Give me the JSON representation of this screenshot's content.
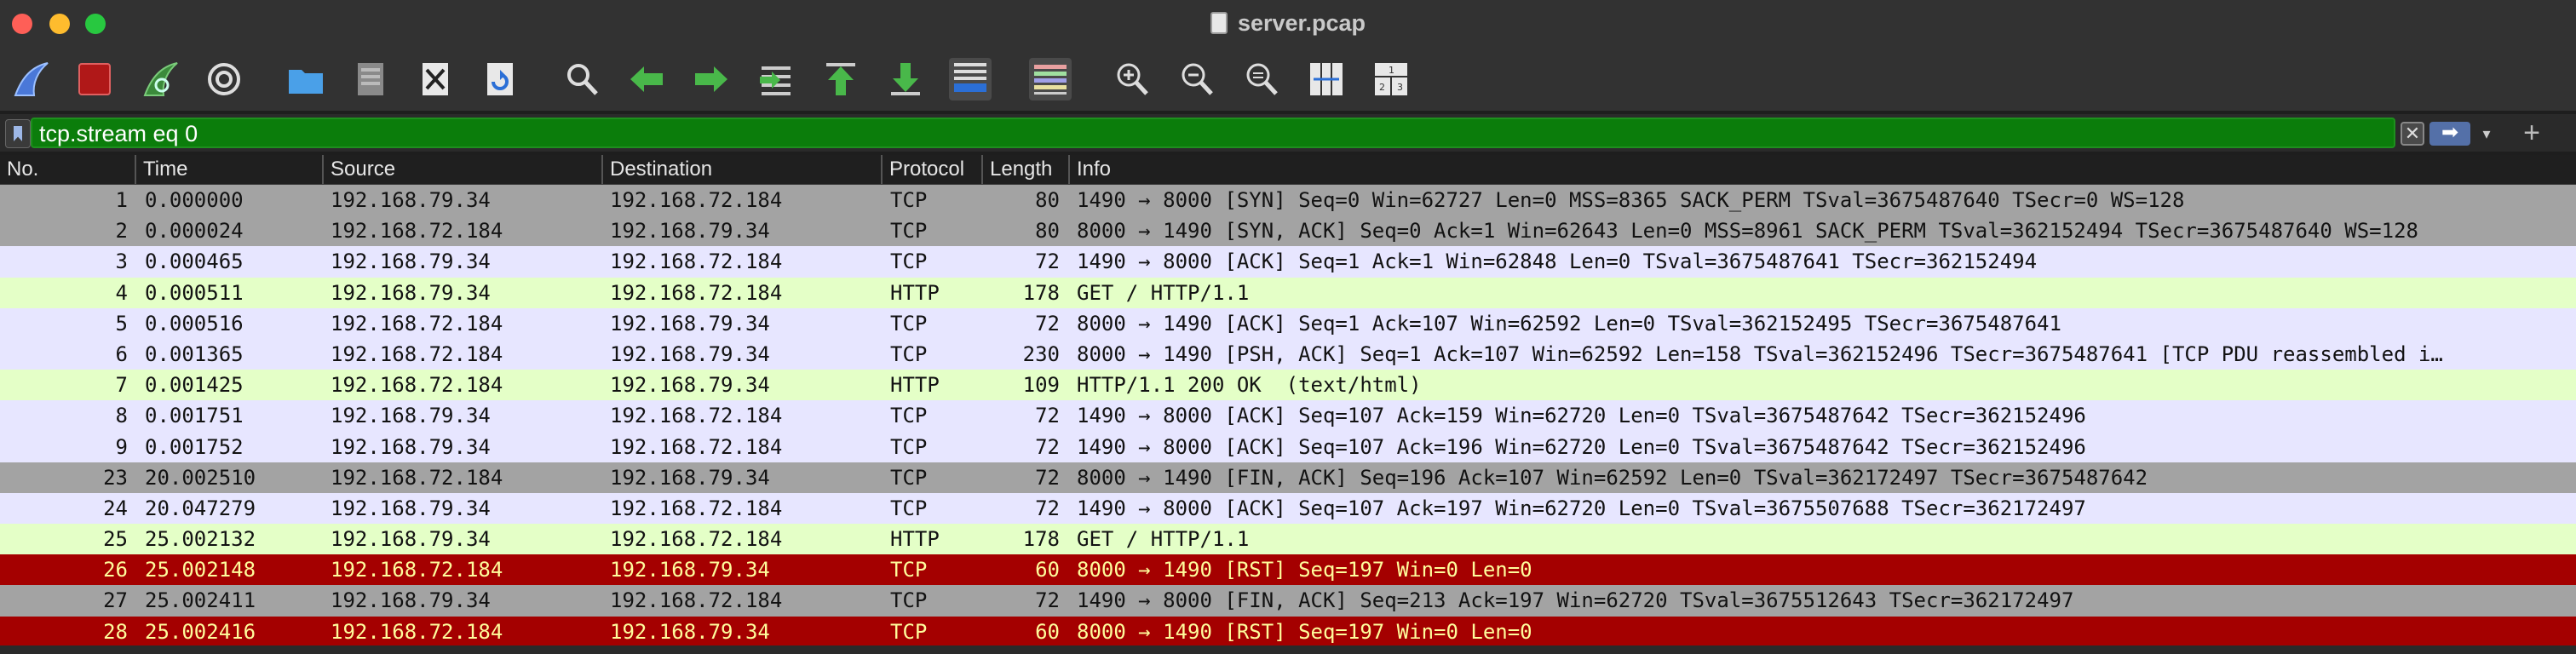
{
  "window": {
    "title": "server.pcap"
  },
  "filter": {
    "value": "tcp.stream eq 0",
    "clear_label": "✕",
    "apply_label": "➡",
    "dropdown_label": "▾",
    "add_label": "+"
  },
  "columns": [
    "No.",
    "Time",
    "Source",
    "Destination",
    "Protocol",
    "Length",
    "Info"
  ],
  "colors": {
    "gray": "#a3a3a3",
    "lavender": "#e7e6ff",
    "lightgreen": "#e4ffc7",
    "darkred": "#a40000",
    "darkred_text": "#fffc9c"
  },
  "packets": [
    {
      "no": "1",
      "time": "0.000000",
      "src": "192.168.79.34",
      "dst": "192.168.72.184",
      "proto": "TCP",
      "len": "80",
      "info": "1490 → 8000 [SYN] Seq=0 Win=62727 Len=0 MSS=8365 SACK_PERM TSval=3675487640 TSecr=0 WS=128",
      "color": "gray"
    },
    {
      "no": "2",
      "time": "0.000024",
      "src": "192.168.72.184",
      "dst": "192.168.79.34",
      "proto": "TCP",
      "len": "80",
      "info": "8000 → 1490 [SYN, ACK] Seq=0 Ack=1 Win=62643 Len=0 MSS=8961 SACK_PERM TSval=362152494 TSecr=3675487640 WS=128",
      "color": "gray"
    },
    {
      "no": "3",
      "time": "0.000465",
      "src": "192.168.79.34",
      "dst": "192.168.72.184",
      "proto": "TCP",
      "len": "72",
      "info": "1490 → 8000 [ACK] Seq=1 Ack=1 Win=62848 Len=0 TSval=3675487641 TSecr=362152494",
      "color": "lavender"
    },
    {
      "no": "4",
      "time": "0.000511",
      "src": "192.168.79.34",
      "dst": "192.168.72.184",
      "proto": "HTTP",
      "len": "178",
      "info": "GET / HTTP/1.1",
      "color": "lightgreen"
    },
    {
      "no": "5",
      "time": "0.000516",
      "src": "192.168.72.184",
      "dst": "192.168.79.34",
      "proto": "TCP",
      "len": "72",
      "info": "8000 → 1490 [ACK] Seq=1 Ack=107 Win=62592 Len=0 TSval=362152495 TSecr=3675487641",
      "color": "lavender"
    },
    {
      "no": "6",
      "time": "0.001365",
      "src": "192.168.72.184",
      "dst": "192.168.79.34",
      "proto": "TCP",
      "len": "230",
      "info": "8000 → 1490 [PSH, ACK] Seq=1 Ack=107 Win=62592 Len=158 TSval=362152496 TSecr=3675487641 [TCP PDU reassembled i…",
      "color": "lavender"
    },
    {
      "no": "7",
      "time": "0.001425",
      "src": "192.168.72.184",
      "dst": "192.168.79.34",
      "proto": "HTTP",
      "len": "109",
      "info": "HTTP/1.1 200 OK  (text/html)",
      "color": "lightgreen"
    },
    {
      "no": "8",
      "time": "0.001751",
      "src": "192.168.79.34",
      "dst": "192.168.72.184",
      "proto": "TCP",
      "len": "72",
      "info": "1490 → 8000 [ACK] Seq=107 Ack=159 Win=62720 Len=0 TSval=3675487642 TSecr=362152496",
      "color": "lavender"
    },
    {
      "no": "9",
      "time": "0.001752",
      "src": "192.168.79.34",
      "dst": "192.168.72.184",
      "proto": "TCP",
      "len": "72",
      "info": "1490 → 8000 [ACK] Seq=107 Ack=196 Win=62720 Len=0 TSval=3675487642 TSecr=362152496",
      "color": "lavender"
    },
    {
      "no": "23",
      "time": "20.002510",
      "src": "192.168.72.184",
      "dst": "192.168.79.34",
      "proto": "TCP",
      "len": "72",
      "info": "8000 → 1490 [FIN, ACK] Seq=196 Ack=107 Win=62592 Len=0 TSval=362172497 TSecr=3675487642",
      "color": "gray"
    },
    {
      "no": "24",
      "time": "20.047279",
      "src": "192.168.79.34",
      "dst": "192.168.72.184",
      "proto": "TCP",
      "len": "72",
      "info": "1490 → 8000 [ACK] Seq=107 Ack=197 Win=62720 Len=0 TSval=3675507688 TSecr=362172497",
      "color": "lavender"
    },
    {
      "no": "25",
      "time": "25.002132",
      "src": "192.168.79.34",
      "dst": "192.168.72.184",
      "proto": "HTTP",
      "len": "178",
      "info": "GET / HTTP/1.1",
      "color": "lightgreen"
    },
    {
      "no": "26",
      "time": "25.002148",
      "src": "192.168.72.184",
      "dst": "192.168.79.34",
      "proto": "TCP",
      "len": "60",
      "info": "8000 → 1490 [RST] Seq=197 Win=0 Len=0",
      "color": "darkred"
    },
    {
      "no": "27",
      "time": "25.002411",
      "src": "192.168.79.34",
      "dst": "192.168.72.184",
      "proto": "TCP",
      "len": "72",
      "info": "1490 → 8000 [FIN, ACK] Seq=213 Ack=197 Win=62720 TSval=3675512643 TSecr=362172497",
      "color": "gray"
    },
    {
      "no": "28",
      "time": "25.002416",
      "src": "192.168.72.184",
      "dst": "192.168.79.34",
      "proto": "TCP",
      "len": "60",
      "info": "8000 → 1490 [RST] Seq=197 Win=0 Len=0",
      "color": "darkred"
    }
  ],
  "toolbar_icons": [
    "shark-fin-start-icon",
    "stop-capture-icon",
    "restart-capture-icon",
    "capture-options-icon",
    "open-folder-icon",
    "save-file-icon",
    "close-file-icon",
    "reload-file-icon",
    "find-packet-icon",
    "go-back-icon",
    "go-forward-icon",
    "go-to-packet-icon",
    "first-packet-icon",
    "last-packet-icon",
    "autoscroll-icon",
    "colorize-icon",
    "zoom-in-icon",
    "zoom-out-icon",
    "normal-size-icon",
    "resize-columns-icon",
    "layout-panes-icon"
  ]
}
